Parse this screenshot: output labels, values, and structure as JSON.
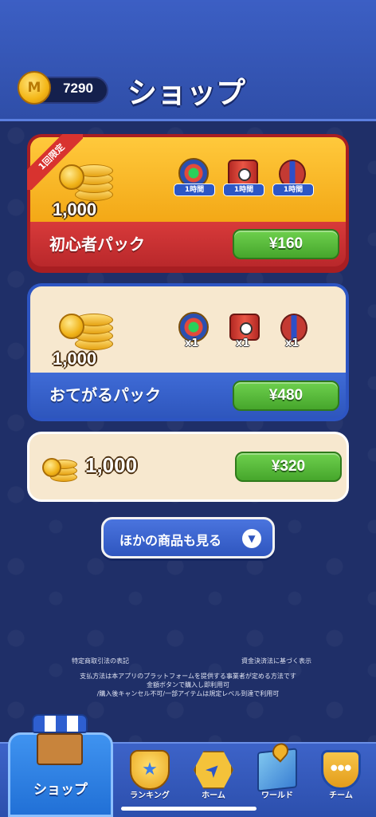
{
  "header": {
    "coin_count": "7290",
    "title": "ショップ"
  },
  "packs": [
    {
      "badge": "1回限定",
      "amount": "1,000",
      "items": [
        {
          "icon": "orb-boost-icon",
          "label": "1時間"
        },
        {
          "icon": "drum-boost-icon",
          "label": "1時間"
        },
        {
          "icon": "capsule-boost-icon",
          "label": "1時間"
        }
      ],
      "name": "初心者パック",
      "price": "¥160"
    },
    {
      "amount": "1,000",
      "items": [
        {
          "icon": "orb-boost-icon",
          "label": "x1"
        },
        {
          "icon": "drum-boost-icon",
          "label": "x1"
        },
        {
          "icon": "capsule-boost-icon",
          "label": "x1"
        }
      ],
      "name": "おてがるパック",
      "price": "¥480"
    },
    {
      "amount": "1,000",
      "price": "¥320"
    }
  ],
  "more_button": "ほかの商品も見る",
  "legal": {
    "link_left": "特定商取引法の表記",
    "link_right": "資金決済法に基づく表示",
    "line1": "支払方法は本アプリのプラットフォームを提供する事業者が定める方法です",
    "line2": "金額ボタンで購入し即利用可",
    "line3": "/購入後キャンセル不可/一部アイテムは規定レベル到達で利用可"
  },
  "tabs": {
    "shop": "ショップ",
    "ranking": "ランキング",
    "home": "ホーム",
    "world": "ワールド",
    "team": "チーム"
  }
}
